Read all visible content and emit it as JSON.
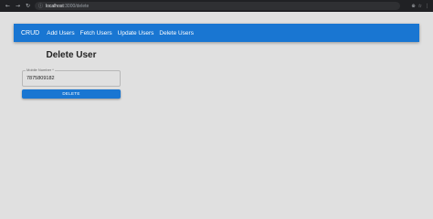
{
  "browser": {
    "back_icon": "←",
    "forward_icon": "→",
    "reload_icon": "↻",
    "info_icon": "ⓘ",
    "url_host": "localhost",
    "url_path": ":3000/delete",
    "toolbar_icons": [
      "⊕",
      "☆",
      "⋮"
    ]
  },
  "appbar": {
    "brand": "CRUD",
    "links": [
      "Add Users",
      "Fetch Users",
      "Update Users",
      "Delete Users"
    ]
  },
  "form": {
    "title": "Delete User",
    "field_label": "Mobile Number *",
    "field_value": "7875809182",
    "button_label": "DELETE"
  }
}
